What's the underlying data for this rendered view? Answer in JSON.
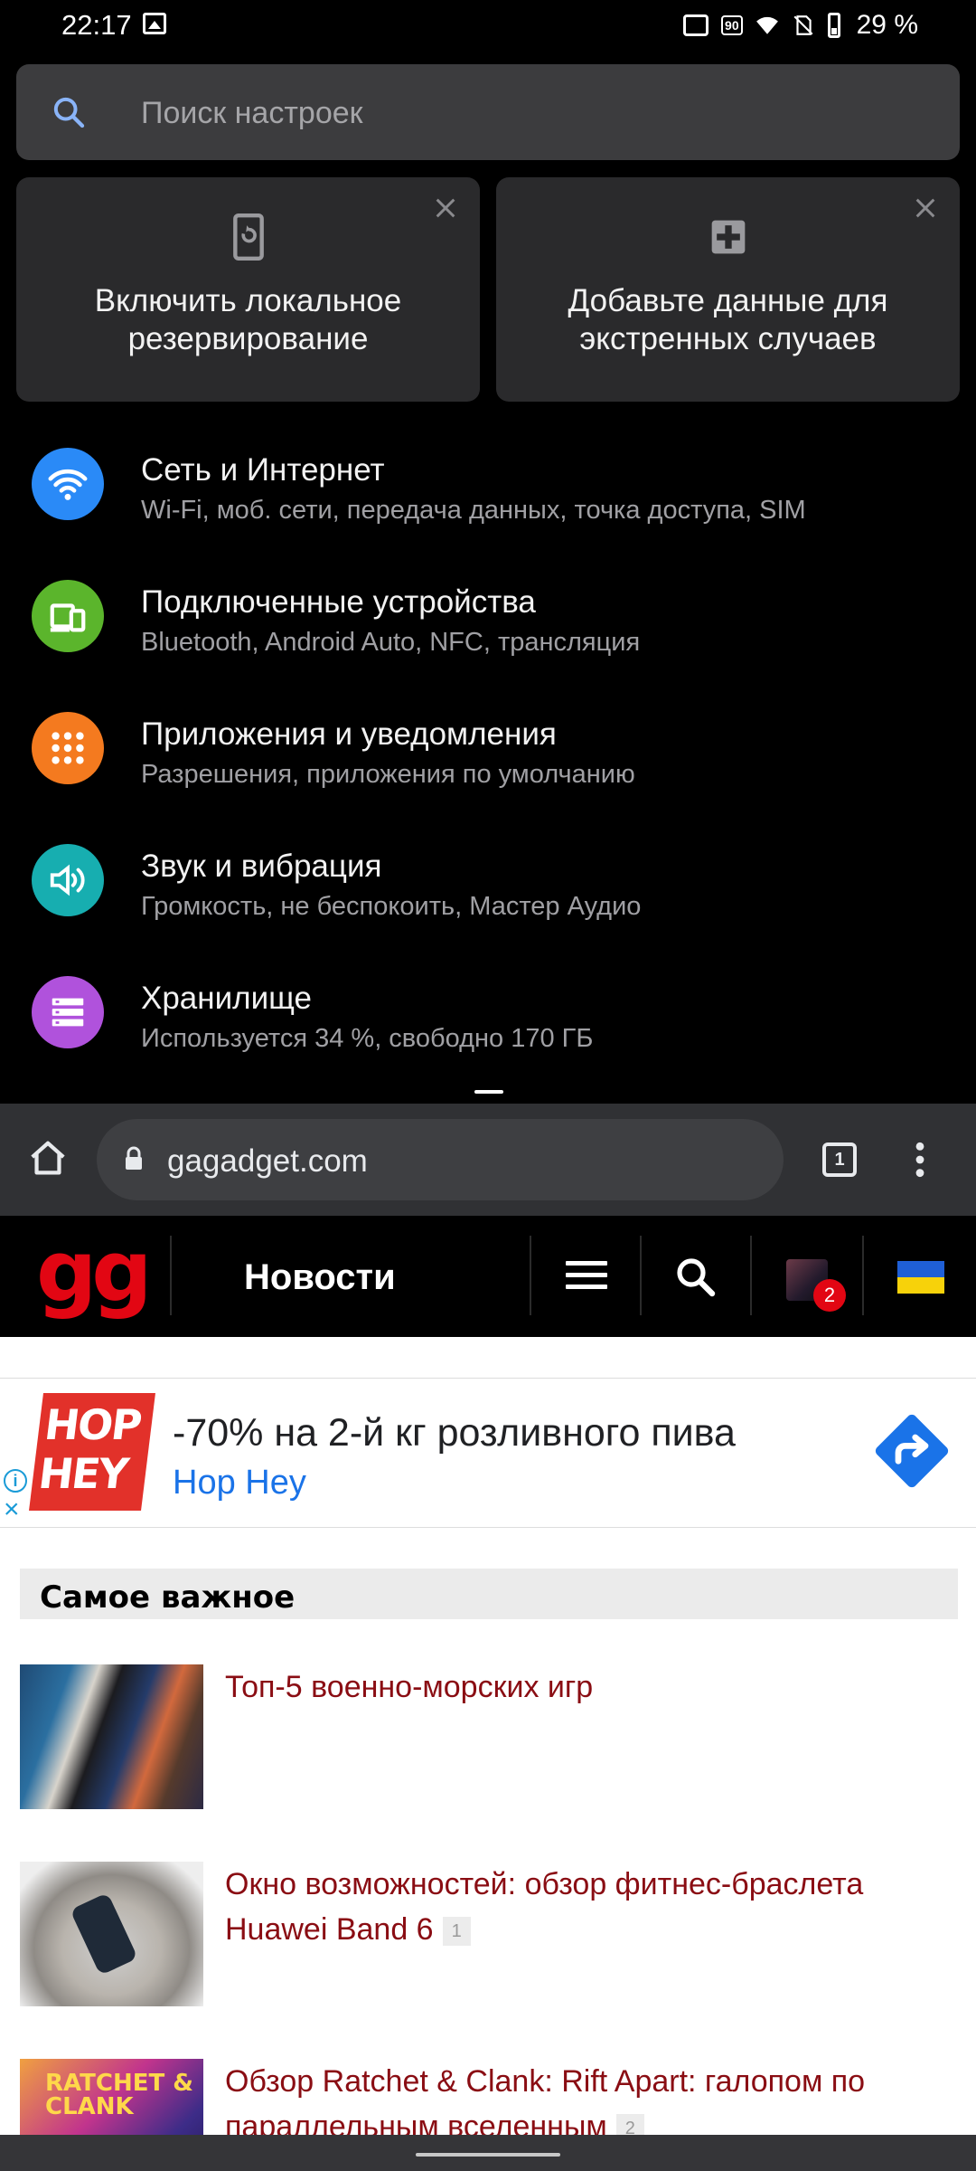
{
  "status_bar": {
    "time": "22:17",
    "battery": "29 %",
    "refresh_badge": "90"
  },
  "settings": {
    "search_placeholder": "Поиск настроек",
    "cards": [
      {
        "title": "Включить локальное резервирование",
        "icon": "phone-backup-icon"
      },
      {
        "title": "Добавьте данные для экстренных случаев",
        "icon": "medical-plus-icon"
      }
    ],
    "items": [
      {
        "title": "Сеть и Интернет",
        "subtitle": "Wi-Fi, моб. сети, передача данных, точка доступа, SIM",
        "icon": "wifi-icon",
        "color": "#2a8af7"
      },
      {
        "title": "Подключенные устройства",
        "subtitle": "Bluetooth, Android Auto, NFC, трансляция",
        "icon": "devices-icon",
        "color": "#5bb52c"
      },
      {
        "title": "Приложения и уведомления",
        "subtitle": "Разрешения, приложения по умолчанию",
        "icon": "apps-grid-icon",
        "color": "#f47a1f"
      },
      {
        "title": "Звук и вибрация",
        "subtitle": "Громкость, не беспокоить, Мастер Аудио",
        "icon": "speaker-icon",
        "color": "#17aeb0"
      },
      {
        "title": "Хранилище",
        "subtitle": "Используется 34 %, свободно 170 ГБ",
        "icon": "storage-icon",
        "color": "#b052dc"
      }
    ]
  },
  "browser": {
    "url": "gagadget.com",
    "tab_count": "1"
  },
  "site": {
    "logo": "gg",
    "nav_label": "Новости",
    "notification_count": "2",
    "brand_color": "#e20613"
  },
  "ad": {
    "logo_text": "HOP HEY",
    "headline": "-70% на 2-й кг розливного пива",
    "brand": "Hop Hey"
  },
  "articles_section": {
    "title": "Самое важное",
    "articles": [
      {
        "title": "Топ-5 военно-морских игр",
        "comments": ""
      },
      {
        "title": "Окно возможностей: обзор фитнес-браслета Huawei Band 6",
        "comments": "1"
      },
      {
        "title": "Обзор Ratchet & Clank: Rift Apart: галопом по параллельным вселенным",
        "comments": "2",
        "thumb_label": "RATCHET & CLANK"
      }
    ]
  }
}
